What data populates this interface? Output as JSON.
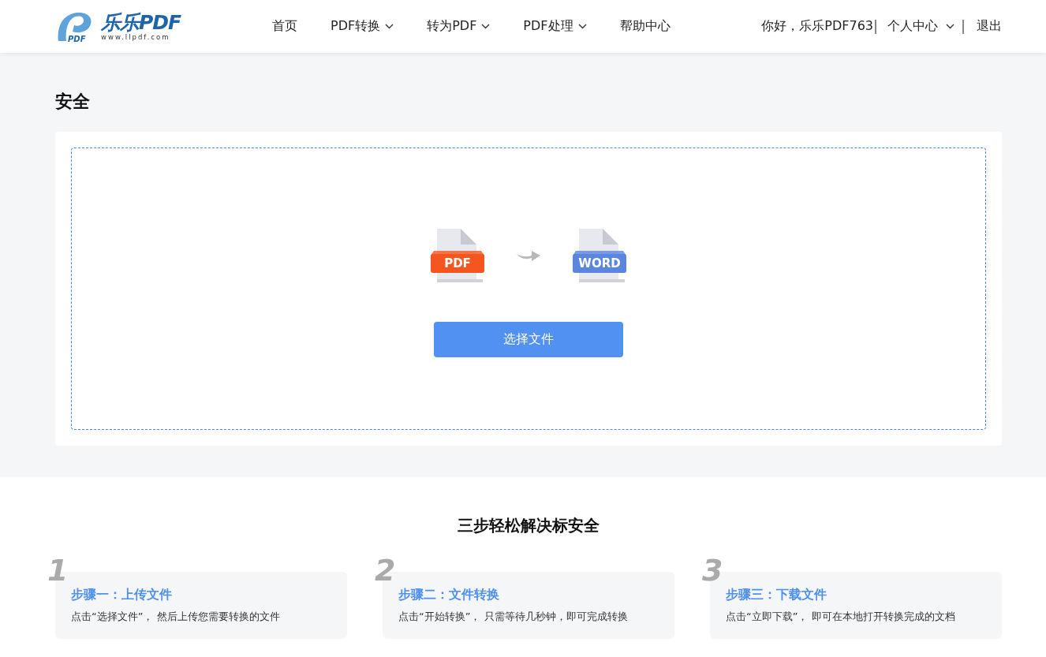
{
  "header": {
    "logo": {
      "mark": "PDF",
      "name": "乐乐PDF",
      "url": "www.llpdf.com"
    },
    "nav": [
      {
        "label": "首页",
        "has_menu": false
      },
      {
        "label": "PDF转换",
        "has_menu": true
      },
      {
        "label": "转为PDF",
        "has_menu": true
      },
      {
        "label": "PDF处理",
        "has_menu": true
      },
      {
        "label": "帮助中心",
        "has_menu": false
      }
    ],
    "greeting": "你好，乐乐PDF763",
    "account": {
      "label": "个人中心",
      "has_menu": true
    },
    "logout": "退出"
  },
  "page_title": "安全",
  "upload": {
    "files": [
      {
        "kind": "pdf",
        "label": "PDF"
      },
      {
        "kind": "word",
        "label": "WORD"
      }
    ],
    "button": "选择文件"
  },
  "steps_title": "三步轻松解决标安全",
  "steps": [
    {
      "number": "1",
      "title": "步骤一：上传文件",
      "text": "点击“选择文件”， 然后上传您需要转换的文件"
    },
    {
      "number": "2",
      "title": "步骤二：文件转换",
      "text": "点击“开始转换”， 只需等待几秒钟，即可完成转换"
    },
    {
      "number": "3",
      "title": "步骤三：下载文件",
      "text": "点击“立即下载”， 即可在本地打开转换完成的文档"
    }
  ]
}
